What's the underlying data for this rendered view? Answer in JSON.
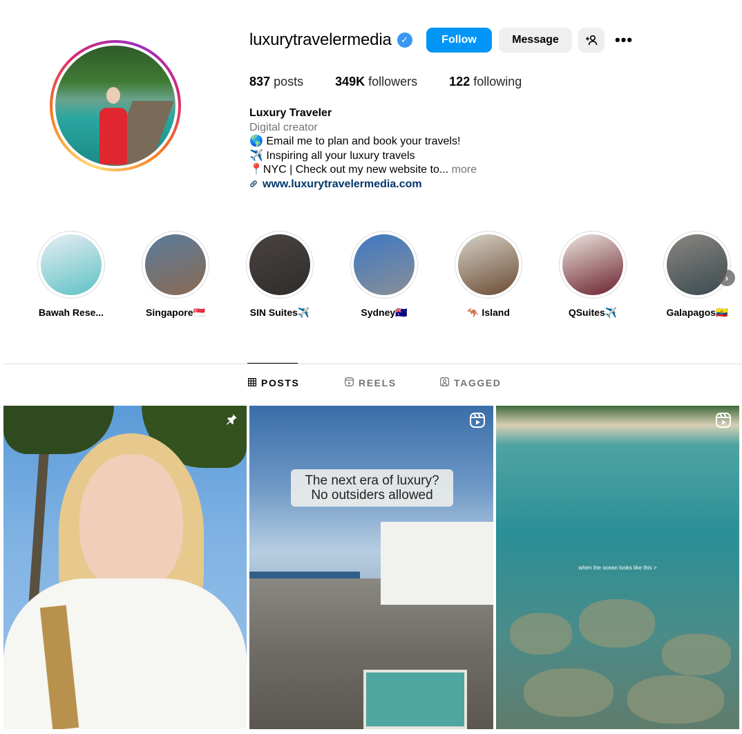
{
  "profile": {
    "username": "luxurytravelermedia",
    "verified_glyph": "✓",
    "buttons": {
      "follow": "Follow",
      "message": "Message",
      "add_user_glyph": "+👤",
      "more_glyph": "•••"
    },
    "stats": [
      {
        "count": "837",
        "label": "posts"
      },
      {
        "count": "349K",
        "label": "followers"
      },
      {
        "count": "122",
        "label": "following"
      }
    ],
    "bio": {
      "name": "Luxury Traveler",
      "category": "Digital creator",
      "lines": [
        "🌎 Email me to plan and book your travels!",
        "✈️ Inspiring all your luxury travels",
        "📍NYC | Check out my new website to..."
      ],
      "more": "more",
      "link_icon_glyph": "🔗",
      "link": "www.luxurytravelermedia.com"
    }
  },
  "highlights": [
    {
      "label": "Bawah Rese...",
      "colors": [
        "#e9eef3",
        "#5cc1c4"
      ]
    },
    {
      "label": "Singapore🇸🇬",
      "colors": [
        "#5a7c9c",
        "#8a6a52"
      ]
    },
    {
      "label": "SIN Suites✈️",
      "colors": [
        "#4a4440",
        "#2f2c2a"
      ]
    },
    {
      "label": "Sydney🇦🇺",
      "colors": [
        "#3d78c4",
        "#8a8f96"
      ]
    },
    {
      "label": "🦘 Island",
      "colors": [
        "#d6d2c8",
        "#6a4a32"
      ]
    },
    {
      "label": "QSuites✈️",
      "colors": [
        "#ece6e0",
        "#6a1f2c"
      ]
    },
    {
      "label": "Galapagos🇪🇨",
      "colors": [
        "#8a8682",
        "#3a4a4e"
      ]
    }
  ],
  "highlights_next_glyph": "›",
  "tabs": [
    {
      "label": "POSTS",
      "icon_glyph": "▦",
      "icon": "grid-icon",
      "active": true
    },
    {
      "label": "REELS",
      "icon_glyph": "▶",
      "icon": "reels-icon",
      "active": false
    },
    {
      "label": "TAGGED",
      "icon_glyph": "👤",
      "icon": "tagged-icon",
      "active": false
    }
  ],
  "posts": [
    {
      "type": "pinned",
      "badge_icon": "pin-icon",
      "badge_glyph": "📌"
    },
    {
      "type": "reel",
      "badge_icon": "reel-icon",
      "badge_glyph": "▶",
      "caption": "The next era of luxury? No outsiders allowed"
    },
    {
      "type": "reel",
      "badge_icon": "reel-icon",
      "badge_glyph": "▶",
      "caption": "when the ocean looks like this >"
    }
  ],
  "colors": {
    "follow_bg": "#0095f6",
    "link": "#00376b",
    "verified": "#3897f0",
    "muted": "#737373"
  }
}
